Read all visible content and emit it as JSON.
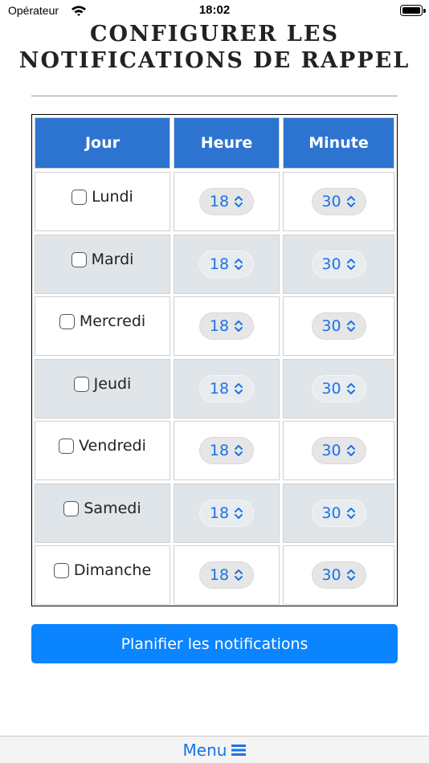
{
  "status_bar": {
    "carrier": "Opérateur",
    "time": "18:02"
  },
  "page": {
    "title": "CONFIGURER LES NOTIFICATIONS DE RAPPEL"
  },
  "table": {
    "headers": [
      "Jour",
      "Heure",
      "Minute"
    ],
    "rows": [
      {
        "day": "Lundi",
        "hour": "18",
        "minute": "30",
        "checked": false
      },
      {
        "day": "Mardi",
        "hour": "18",
        "minute": "30",
        "checked": false
      },
      {
        "day": "Mercredi",
        "hour": "18",
        "minute": "30",
        "checked": false
      },
      {
        "day": "Jeudi",
        "hour": "18",
        "minute": "30",
        "checked": false
      },
      {
        "day": "Vendredi",
        "hour": "18",
        "minute": "30",
        "checked": false
      },
      {
        "day": "Samedi",
        "hour": "18",
        "minute": "30",
        "checked": false
      },
      {
        "day": "Dimanche",
        "hour": "18",
        "minute": "30",
        "checked": false
      }
    ]
  },
  "actions": {
    "submit_label": "Planifier les notifications"
  },
  "bottom_menu": {
    "label": "Menu",
    "icon": "hamburger-icon"
  },
  "colors": {
    "header_bg": "#2d74d1",
    "button_bg": "#0a84ff",
    "select_text": "#1a73e8",
    "alt_row": "#e0e5e9"
  }
}
